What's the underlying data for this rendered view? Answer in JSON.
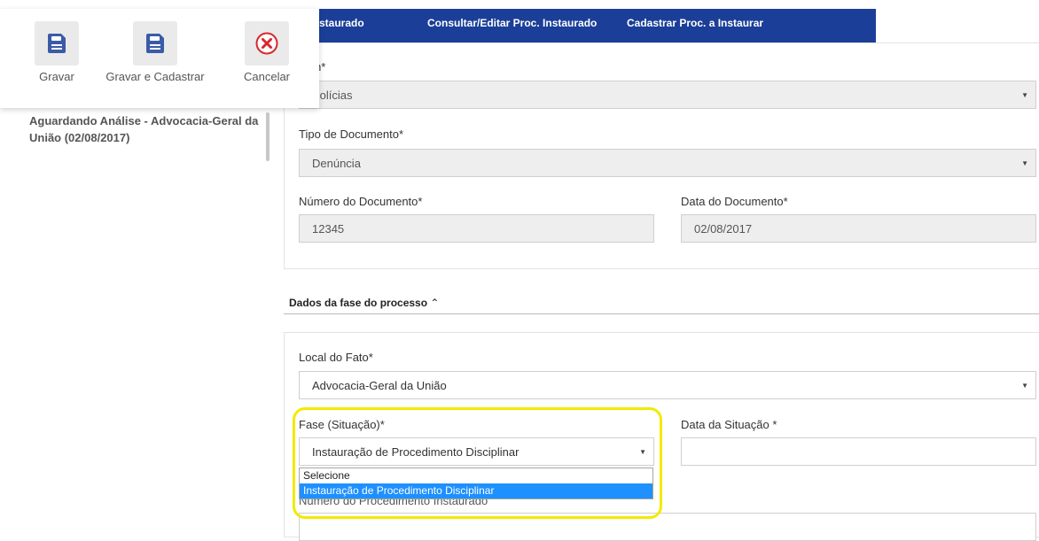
{
  "nav": {
    "items": [
      "roc. Instaurado",
      "Consultar/Editar Proc. Instaurado",
      "Cadastrar Proc. a Instaurar"
    ]
  },
  "toolbar": {
    "save_label": "Gravar",
    "save_register_label": "Gravar e Cadastrar",
    "cancel_label": "Cancelar"
  },
  "sidebar": {
    "status": "Aguardando Análise - Advocacia-Geral da União (02/08/2017)"
  },
  "document": {
    "origem_label": "gem*",
    "origem_value": "Polícias",
    "tipo_label": "Tipo de Documento*",
    "tipo_value": "Denúncia",
    "numero_label": "Número do Documento*",
    "numero_value": "12345",
    "data_label": "Data do Documento*",
    "data_value": "02/08/2017"
  },
  "phase": {
    "section_title": "Dados da fase do processo",
    "local_label": "Local do Fato*",
    "local_value": "Advocacia-Geral da União",
    "fase_label": "Fase (Situação)*",
    "fase_value": "Instauração de Procedimento Disciplinar",
    "data_situacao_label": "Data da Situação *",
    "data_situacao_value": "",
    "numero_proc_label": "Número do Procedimento Instaurado",
    "fase_options": [
      "Selecione",
      "Instauração de Procedimento Disciplinar"
    ],
    "fase_selected_index": 1
  },
  "colors": {
    "nav_bg": "#1b3f98",
    "icon_blue": "#3a5ba8",
    "cancel_red": "#d9272e",
    "highlight": "#f2ea00",
    "option_selected": "#1e90ff"
  }
}
